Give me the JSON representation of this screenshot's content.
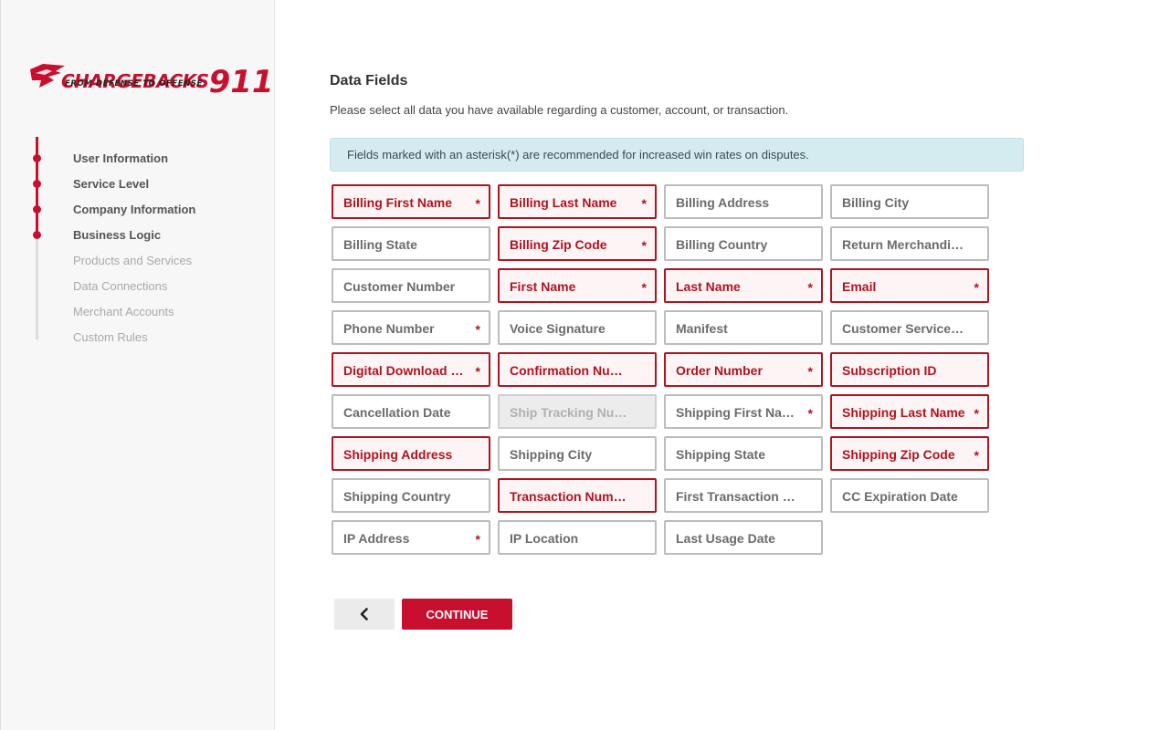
{
  "brand": {
    "name_main": "CHARGEBACKS",
    "name_num": "911",
    "tagline": "FROM DEFENSE TO OFFENSE",
    "accent": "#c8102e"
  },
  "steps": [
    {
      "label": "User Information",
      "state": "done"
    },
    {
      "label": "Service Level",
      "state": "done"
    },
    {
      "label": "Company Information",
      "state": "done"
    },
    {
      "label": "Business Logic",
      "state": "done"
    },
    {
      "label": "Products and Services",
      "state": "todo"
    },
    {
      "label": "Data Connections",
      "state": "todo"
    },
    {
      "label": "Merchant Accounts",
      "state": "todo"
    },
    {
      "label": "Custom Rules",
      "state": "todo"
    }
  ],
  "main": {
    "title": "Data Fields",
    "subtitle": "Please select all data you have available regarding a customer, account, or transaction.",
    "notice": "Fields marked with an asterisk(*) are recommended for increased win rates on disputes."
  },
  "fields": [
    {
      "label": "Billing First Name",
      "selected": true,
      "recommended": true
    },
    {
      "label": "Billing Last Name",
      "selected": true,
      "recommended": true
    },
    {
      "label": "Billing Address",
      "selected": false,
      "recommended": false
    },
    {
      "label": "Billing City",
      "selected": false,
      "recommended": false
    },
    {
      "label": "Billing State",
      "selected": false,
      "recommended": false
    },
    {
      "label": "Billing Zip Code",
      "selected": true,
      "recommended": true
    },
    {
      "label": "Billing Country",
      "selected": false,
      "recommended": false
    },
    {
      "label": "Return Merchandis...",
      "selected": false,
      "recommended": false
    },
    {
      "label": "Customer Number",
      "selected": false,
      "recommended": false
    },
    {
      "label": "First Name",
      "selected": true,
      "recommended": true
    },
    {
      "label": "Last Name",
      "selected": true,
      "recommended": true
    },
    {
      "label": "Email",
      "selected": true,
      "recommended": true
    },
    {
      "label": "Phone Number",
      "selected": false,
      "recommended": true
    },
    {
      "label": "Voice Signature",
      "selected": false,
      "recommended": false
    },
    {
      "label": "Manifest",
      "selected": false,
      "recommended": false
    },
    {
      "label": "Customer Service N...",
      "selected": false,
      "recommended": false
    },
    {
      "label": "Digital Download N...",
      "selected": true,
      "recommended": true
    },
    {
      "label": "Confirmation Number",
      "selected": true,
      "recommended": false
    },
    {
      "label": "Order Number",
      "selected": true,
      "recommended": true
    },
    {
      "label": "Subscription ID",
      "selected": true,
      "recommended": false
    },
    {
      "label": "Cancellation Date",
      "selected": false,
      "recommended": false
    },
    {
      "label": "Ship Tracking Num...",
      "selected": false,
      "recommended": false,
      "disabled": true
    },
    {
      "label": "Shipping First Name",
      "selected": false,
      "recommended": true
    },
    {
      "label": "Shipping Last Name",
      "selected": true,
      "recommended": true
    },
    {
      "label": "Shipping Address",
      "selected": true,
      "recommended": false
    },
    {
      "label": "Shipping City",
      "selected": false,
      "recommended": false
    },
    {
      "label": "Shipping State",
      "selected": false,
      "recommended": false
    },
    {
      "label": "Shipping Zip Code",
      "selected": true,
      "recommended": true
    },
    {
      "label": "Shipping Country",
      "selected": false,
      "recommended": false
    },
    {
      "label": "Transaction Number",
      "selected": true,
      "recommended": false
    },
    {
      "label": "First Transaction Date",
      "selected": false,
      "recommended": false
    },
    {
      "label": "CC Expiration Date",
      "selected": false,
      "recommended": false
    },
    {
      "label": "IP Address",
      "selected": false,
      "recommended": true
    },
    {
      "label": "IP Location",
      "selected": false,
      "recommended": false
    },
    {
      "label": "Last Usage Date",
      "selected": false,
      "recommended": false
    }
  ],
  "asterisk": "*",
  "buttons": {
    "back_icon": "chevron-left-icon",
    "continue_label": "CONTINUE"
  }
}
